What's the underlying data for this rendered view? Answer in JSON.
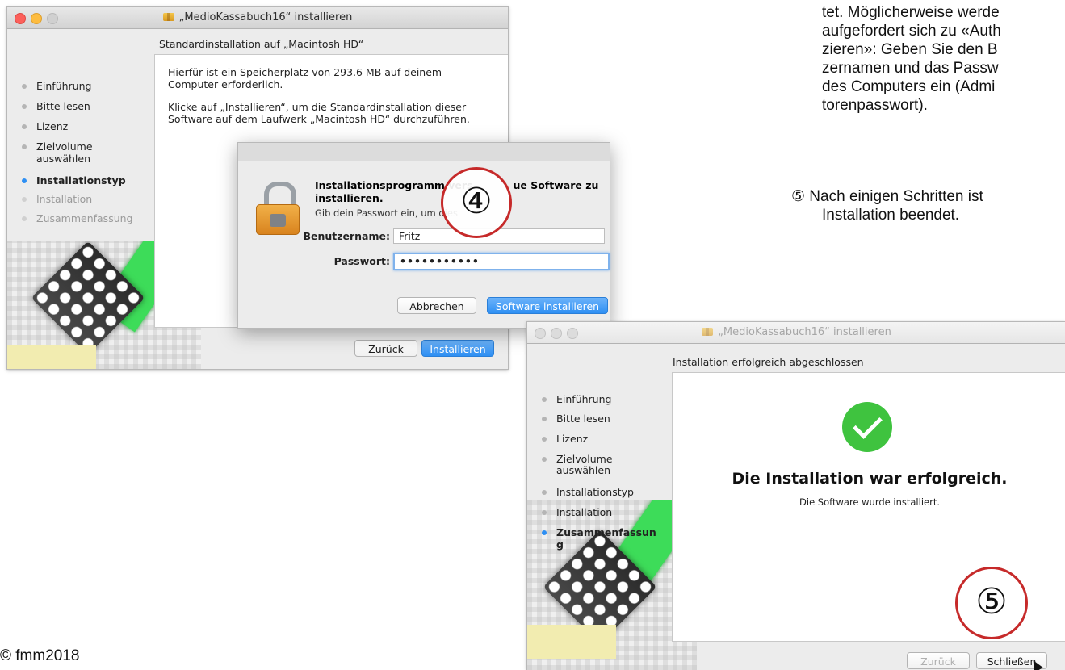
{
  "install_window": {
    "title": "„MedioKassabuch16“ installieren",
    "heading": "Standardinstallation auf „Macintosh HD“",
    "body_line1": "Hierfür ist ein Speicherplatz von 293.6 MB auf deinem",
    "body_line2": "Computer erforderlich.",
    "body_line3": "Klicke auf „Installieren“, um die Standardinstallation dieser",
    "body_line4": "Software auf dem Laufwerk „Macintosh HD“ durchzuführen.",
    "steps": [
      {
        "label": "Einführung"
      },
      {
        "label": "Bitte lesen"
      },
      {
        "label": "Lizenz"
      },
      {
        "label": "Zielvolume"
      },
      {
        "label": "auswählen"
      },
      {
        "label": "Installationstyp"
      },
      {
        "label": "Installation"
      },
      {
        "label": "Zusammenfassung"
      }
    ],
    "back_label": "Zurück",
    "install_label": "Installieren"
  },
  "auth_dialog": {
    "heading_line1": "Installationsprogramm vers",
    "heading_line1b": "ue Software zu",
    "heading_line2": "installieren.",
    "subtext": "Gib dein Passwort ein, um dies",
    "username_label": "Benutzername:",
    "username_value": "Fritz",
    "password_label": "Passwort:",
    "password_value": "•••••••••••",
    "cancel_label": "Abbrechen",
    "confirm_label": "Software installieren"
  },
  "callouts": {
    "step4": "④",
    "step5": "⑤"
  },
  "instructions": {
    "line1": "tet. Möglicherweise werde",
    "line2": "aufgefordert sich zu «Auth",
    "line3": "zieren»: Geben Sie den B",
    "line4": "zernamen und das Passw",
    "line5": "des Computers ein (Admi",
    "line6": "torenpasswort).",
    "step5_line1": "⑤ Nach einigen Schritten ist",
    "step5_line2": "Installation beendet."
  },
  "success_window": {
    "title": "„MedioKassabuch16“ installieren",
    "heading": "Installation erfolgreich abgeschlossen",
    "steps": [
      {
        "label": "Einführung"
      },
      {
        "label": "Bitte lesen"
      },
      {
        "label": "Lizenz"
      },
      {
        "label": "Zielvolume"
      },
      {
        "label": "auswählen"
      },
      {
        "label": "Installationstyp"
      },
      {
        "label": "Installation"
      },
      {
        "label": "Zusammenfassun"
      },
      {
        "label": "g"
      }
    ],
    "success_title": "Die Installation war erfolgreich.",
    "success_sub": "Die Software wurde installiert.",
    "back_label": "Zurück",
    "close_label": "Schließen"
  },
  "footer": {
    "copyright": "© fmm2018"
  },
  "colors": {
    "accent": "#2e8ff3",
    "callout": "#c62a2a",
    "success": "#3fc33f"
  }
}
